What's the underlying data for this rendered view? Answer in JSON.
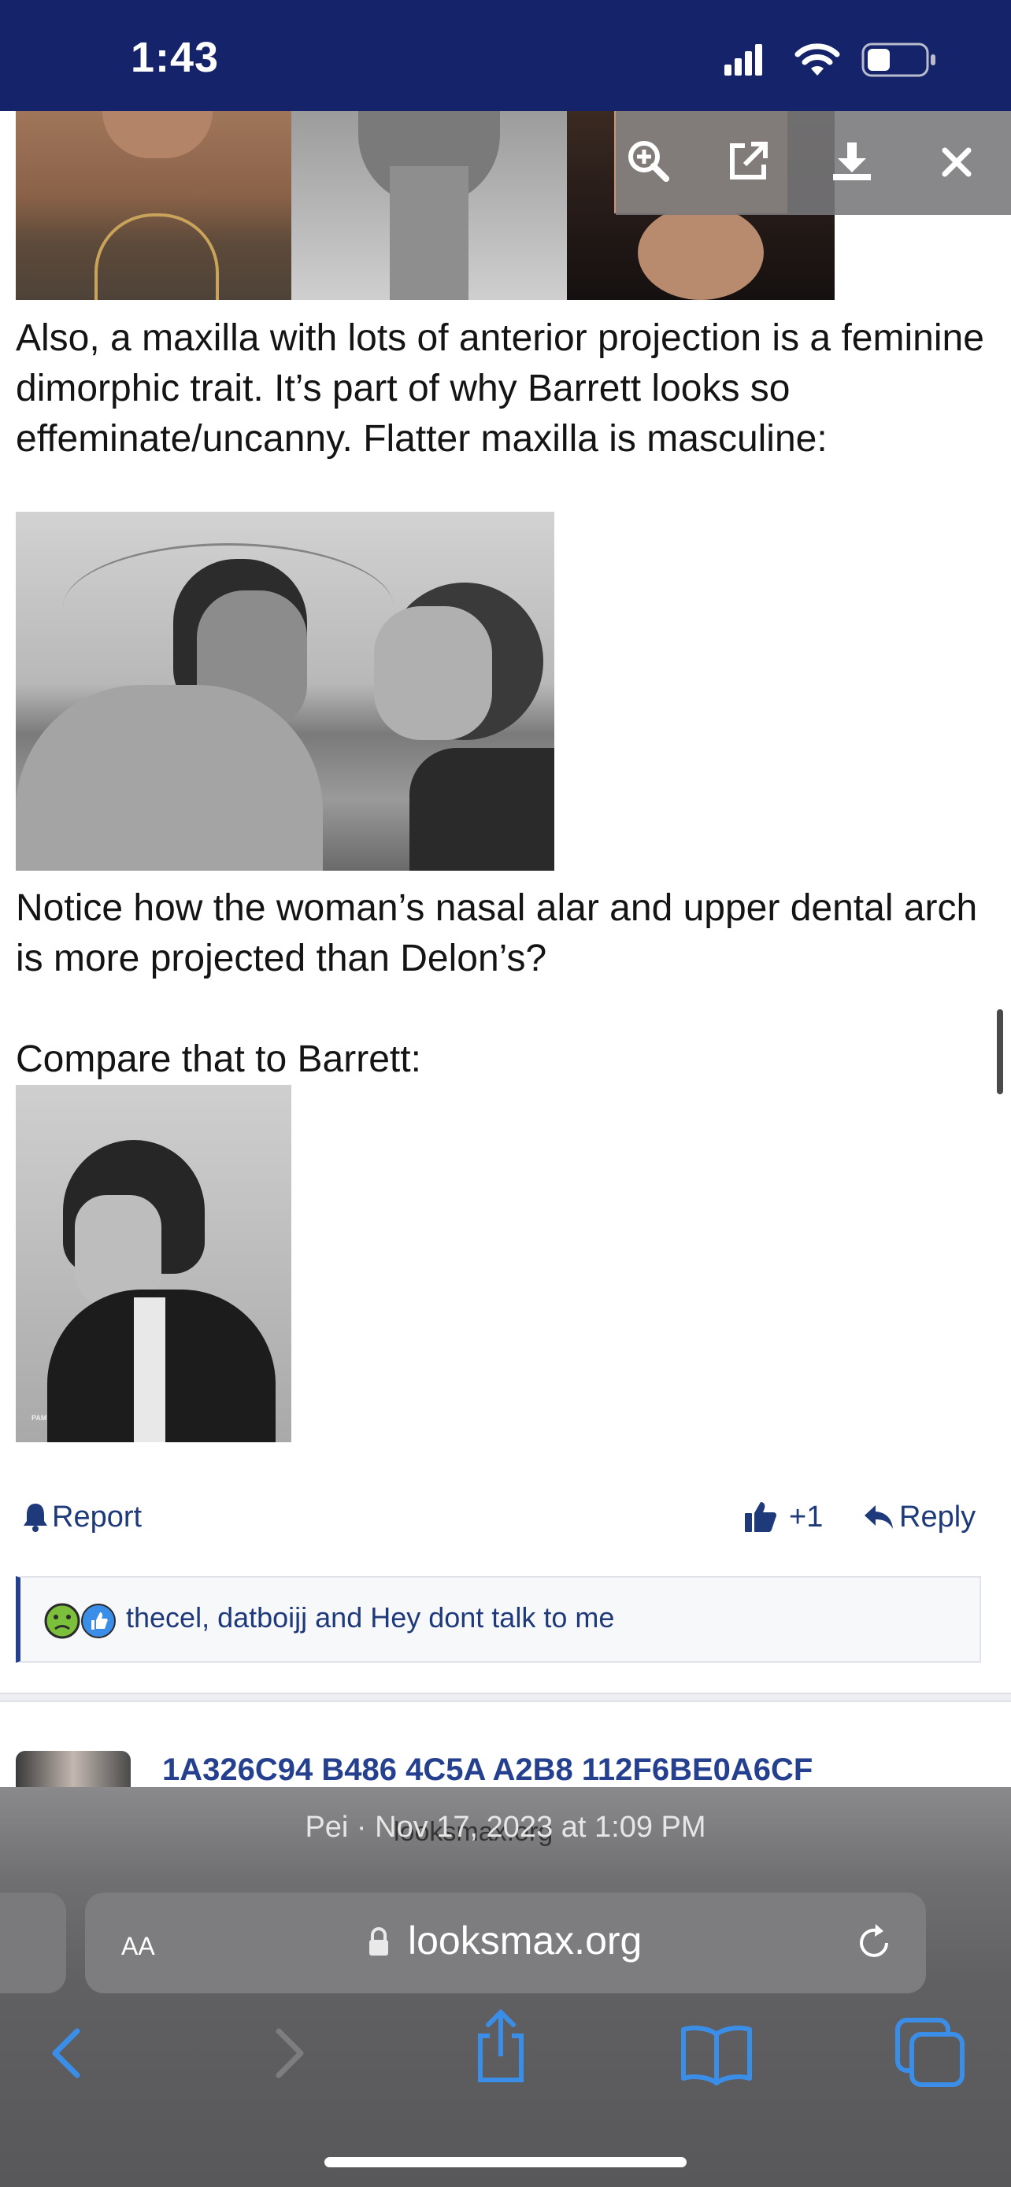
{
  "status_bar": {
    "time": "1:43"
  },
  "viewer_toolbar": {
    "icons": [
      "zoom-in-icon",
      "open-external-icon",
      "download-icon",
      "close-icon"
    ]
  },
  "post": {
    "paragraph_1": "Also, a maxilla with lots of anterior projection is a feminine dimorphic trait. It’s part of why Barrett looks so effeminate/uncanny. Flatter maxilla is masculine:",
    "paragraph_2": "Notice how the woman’s nasal alar and upper dental arch is more projected than Delon’s?",
    "paragraph_3": "Compare that to Barrett:",
    "magazine_caption": "PAM",
    "actions": {
      "report": "Report",
      "like_count": "+1",
      "reply": "Reply"
    },
    "reactions_text": "thecel, datboijj and Hey dont talk to me",
    "next_post_title": "1A326C94 B486 4C5A A2B8 112F6BE0A6CF",
    "next_post_meta": "Pei · Nov 17, 2023 at 1:09 PM",
    "next_post_overlay_site": "looksmax.org"
  },
  "browser": {
    "aa_label": "AA",
    "url": "looksmax.org"
  },
  "colors": {
    "status_bar": "#15246a",
    "link": "#1f3a7a",
    "accent_border": "#25408f"
  }
}
